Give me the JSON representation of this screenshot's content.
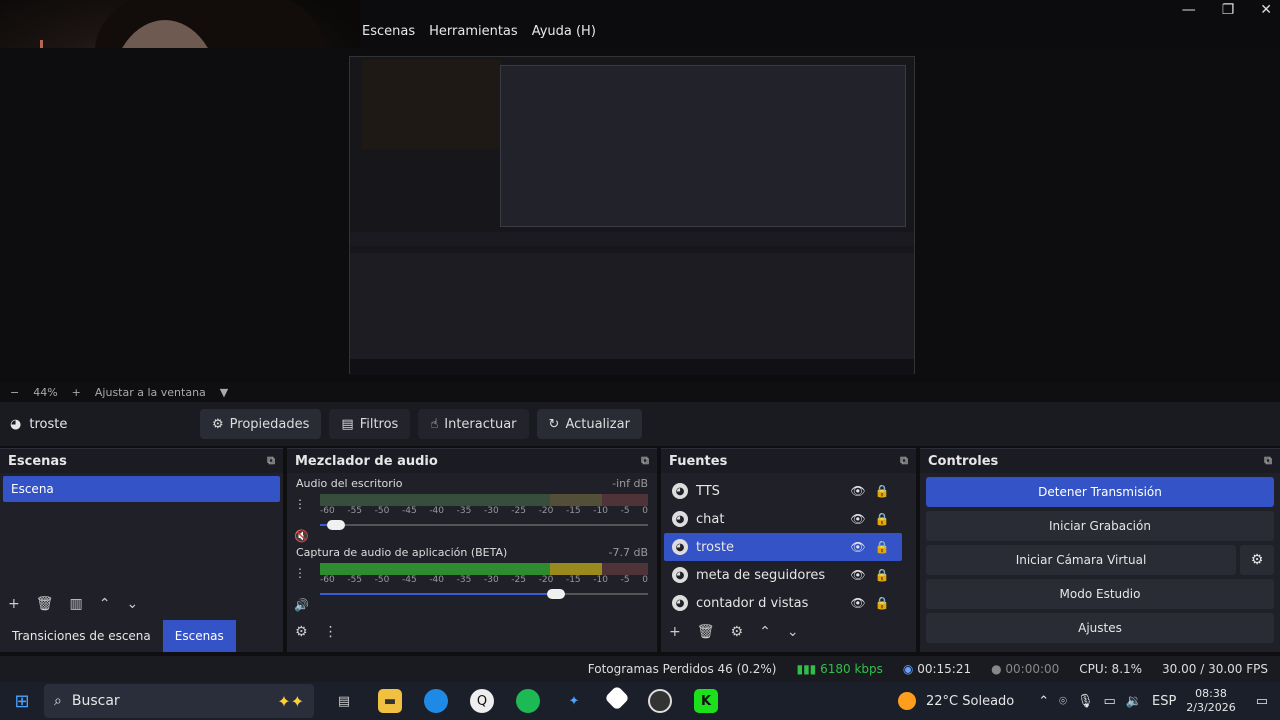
{
  "menu": [
    "Escenas",
    "Herramientas",
    "Ayuda (H)"
  ],
  "window_controls": [
    "—",
    "❐",
    "✕"
  ],
  "zoom": {
    "minus": "−",
    "value": "44%",
    "plus": "+",
    "fit": "Ajustar a la ventana",
    "dropdown": "▼"
  },
  "source_bar": {
    "name": "troste",
    "properties": "Propiedades",
    "filters": "Filtros",
    "interact": "Interactuar",
    "refresh": "Actualizar"
  },
  "scenes": {
    "title": "Escenas",
    "items": [
      "Escena"
    ],
    "tabs": [
      "Transiciones de escena",
      "Escenas"
    ]
  },
  "mixer": {
    "title": "Mezclador de audio",
    "ticks": [
      "-60",
      "-55",
      "-50",
      "-45",
      "-40",
      "-35",
      "-30",
      "-25",
      "-20",
      "-15",
      "-10",
      "-5",
      "0"
    ],
    "channels": [
      {
        "name": "Audio del escritorio",
        "db": "-inf dB",
        "level": 0.0,
        "volume": 0.05
      },
      {
        "name": "Captura de audio de aplicación (BETA)",
        "db": "-7.7 dB",
        "level": 0.84,
        "volume": 0.72
      }
    ]
  },
  "sources": {
    "title": "Fuentes",
    "items": [
      {
        "name": "TTS",
        "selected": false
      },
      {
        "name": "chat",
        "selected": false
      },
      {
        "name": "troste",
        "selected": true
      },
      {
        "name": "meta de seguidores",
        "selected": false
      },
      {
        "name": "contador d vistas",
        "selected": false
      }
    ]
  },
  "controls": {
    "title": "Controles",
    "stop_stream": "Detener Transmisión",
    "start_recording": "Iniciar Grabación",
    "start_virtual_cam": "Iniciar Cámara Virtual",
    "studio_mode": "Modo Estudio",
    "settings": "Ajustes"
  },
  "status": {
    "dropped": "Fotogramas Perdidos 46 (0.2%)",
    "kbps": "6180 kbps",
    "stream_time": "00:15:21",
    "rec_time": "00:00:00",
    "cpu": "CPU: 8.1%",
    "fps": "30.00 / 30.00 FPS"
  },
  "taskbar": {
    "search": "Buscar",
    "weather": "22°C  Soleado",
    "lang": "ESP",
    "time": "08:38",
    "date": "2/3/2026"
  },
  "colors": {
    "accent": "#3453c6",
    "meter_green": "#2e8b2e",
    "meter_yellow": "#9a8a1e",
    "meter_red": "#8a1e22"
  }
}
